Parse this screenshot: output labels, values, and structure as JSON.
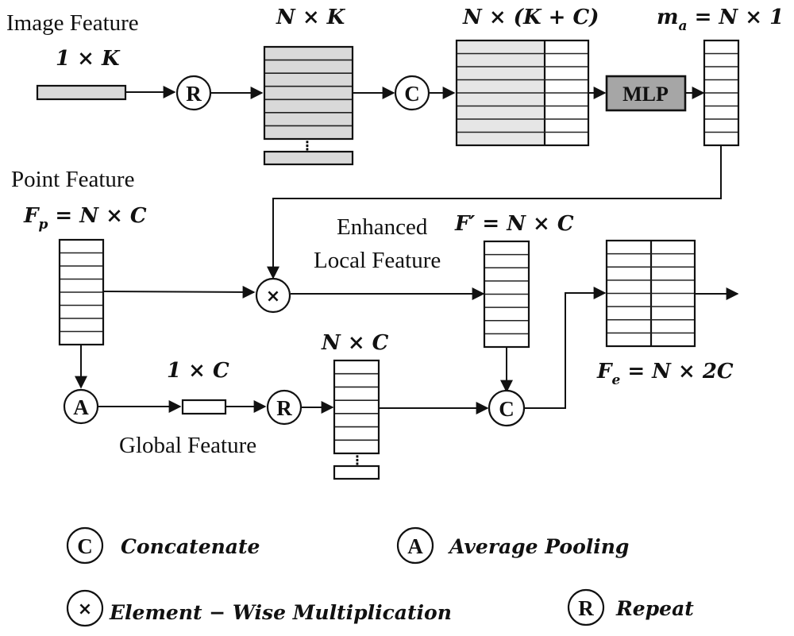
{
  "figure": {
    "labels": {
      "image_feature": "Image Feature",
      "point_feature": "Point Feature",
      "enhanced_1": "Enhanced",
      "enhanced_2": "Local Feature",
      "global_feature": "Global Feature",
      "mlp": "MLP"
    },
    "math": {
      "one_by_k": "1 × K",
      "n_by_k": "N × K",
      "n_by_kc": "N × (K + C)",
      "ma_main": "m",
      "ma_sub": "a",
      "ma_rhs": " = N × 1",
      "fp_main": "F",
      "fp_sub": "p",
      "fp_rhs": " = N × C",
      "fprime": "F′ = N × C",
      "one_by_c": "1 × C",
      "n_by_c": "N × C",
      "fe_main": "F",
      "fe_sub": "e",
      "fe_rhs": " = N × 2C"
    },
    "operators": {
      "repeat": "R",
      "concat": "C",
      "multiply": "×",
      "avgpool": "A"
    },
    "colors": {
      "gray_fill": "#d9d9d9",
      "light_gray_fill": "#e6e6e6",
      "mlp_fill": "#a6a6a6",
      "stroke": "#111111"
    }
  },
  "legend": [
    {
      "symbol": "C",
      "label": "Concatenate"
    },
    {
      "symbol": "A",
      "label": "Average Pooling"
    },
    {
      "symbol": "×",
      "label": "Element − Wise Multiplication"
    },
    {
      "symbol": "R",
      "label": "Repeat"
    }
  ]
}
